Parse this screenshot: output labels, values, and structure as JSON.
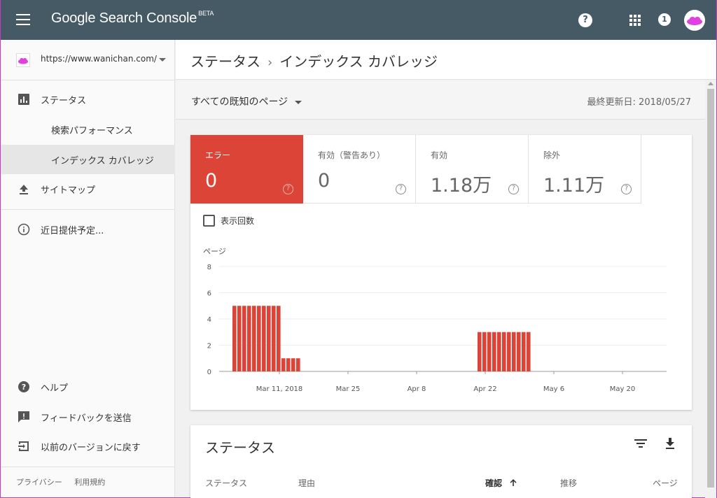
{
  "app": {
    "title": "Google Search Console",
    "badge": "BETA",
    "help_icon": "help-icon",
    "notifications_count": "1"
  },
  "sidebar": {
    "property_url": "https://www.wanichan.com/",
    "items": [
      {
        "label": "ステータス",
        "icon": "bar-chart-icon"
      },
      {
        "label": "検索パフォーマンス"
      },
      {
        "label": "インデックス カバレッジ"
      },
      {
        "label": "サイトマップ",
        "icon": "upload-icon"
      },
      {
        "label": "近日提供予定...",
        "icon": "info-icon"
      },
      {
        "label": "ヘルプ",
        "icon": "help-circle-icon"
      },
      {
        "label": "フィードバックを送信",
        "icon": "feedback-icon"
      },
      {
        "label": "以前のバージョンに戻す",
        "icon": "exit-icon"
      }
    ],
    "footer": {
      "privacy": "プライバシー",
      "terms": "利用規約"
    }
  },
  "header": {
    "breadcrumb_root": "ステータス",
    "breadcrumb_sep": "›",
    "breadcrumb_current": "インデックス カバレッジ"
  },
  "filter": {
    "selected": "すべての既知のページ",
    "last_updated": "最終更新日: 2018/05/27"
  },
  "metrics": [
    {
      "label": "エラー",
      "value": "0",
      "help": "?"
    },
    {
      "label": "有効（警告あり）",
      "value": "0",
      "help": "?"
    },
    {
      "label": "有効",
      "value": "1.18万",
      "help": "?"
    },
    {
      "label": "除外",
      "value": "1.11万",
      "help": "?"
    }
  ],
  "impressions_toggle": {
    "label": "表示回数",
    "checked": false
  },
  "chart_data": {
    "type": "bar",
    "ylabel": "ページ",
    "ylim": [
      0,
      8
    ],
    "yticks": [
      0,
      2,
      4,
      6,
      8
    ],
    "xticks": [
      "Mar 11, 2018",
      "Mar 25",
      "Apr 8",
      "Apr 22",
      "May 6",
      "May 20"
    ],
    "color": "#db4437",
    "values": [
      5,
      5,
      5,
      5,
      5,
      5,
      5,
      5,
      5,
      5,
      1,
      1,
      1,
      1,
      0,
      0,
      0,
      0,
      0,
      0,
      0,
      0,
      0,
      0,
      0,
      0,
      0,
      0,
      0,
      0,
      0,
      0,
      0,
      0,
      0,
      0,
      0,
      0,
      0,
      0,
      0,
      0,
      0,
      0,
      0,
      0,
      0,
      0,
      0,
      0,
      3,
      3,
      3,
      3,
      3,
      3,
      3,
      3,
      3,
      3,
      3
    ]
  },
  "table": {
    "title": "ステータス",
    "headers": [
      "ステータス",
      "理由",
      "確認",
      "推移",
      "ページ"
    ],
    "sort_icon": "arrow-up-icon"
  },
  "colors": {
    "appbar": "#455a64",
    "error": "#db4437"
  }
}
